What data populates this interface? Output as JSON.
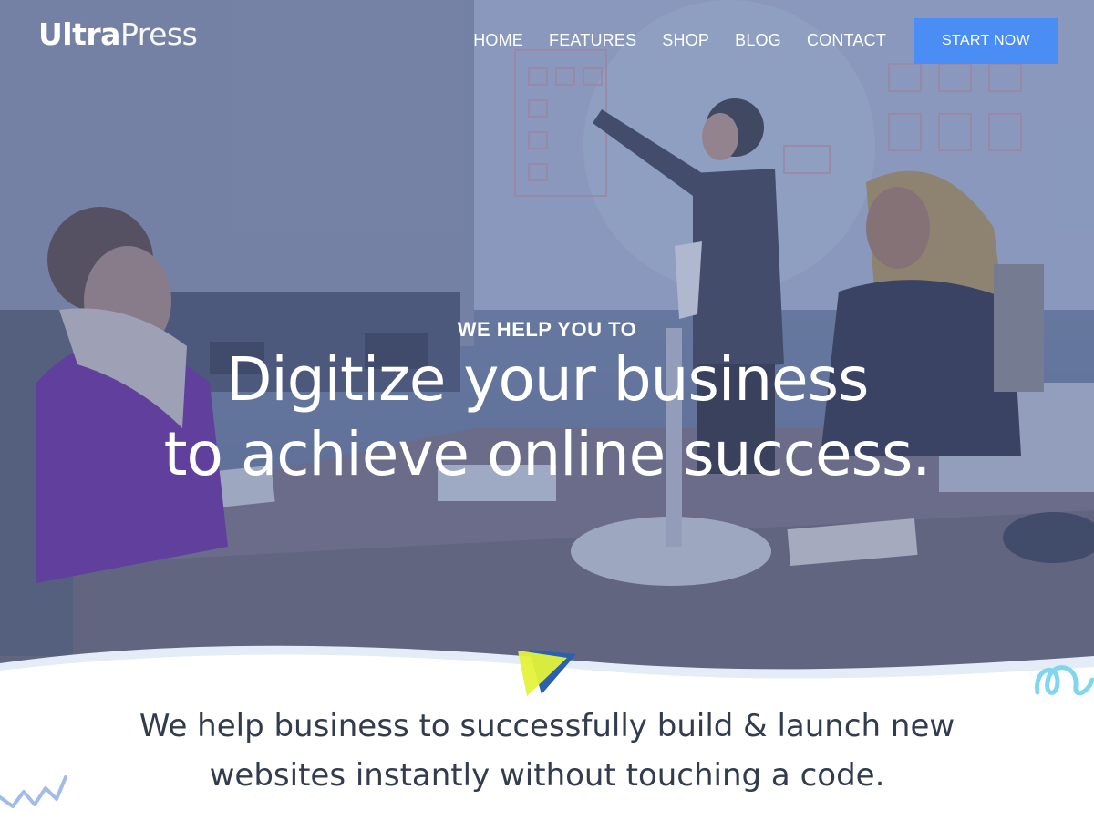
{
  "brand": {
    "name_bold": "Ultra",
    "name_light": "Press"
  },
  "nav": {
    "items": [
      "HOME",
      "FEATURES",
      "SHOP",
      "BLOG",
      "CONTACT"
    ],
    "cta_label": "START NOW"
  },
  "hero": {
    "eyebrow": "WE HELP YOU TO",
    "headline_line1": "Digitize your business",
    "headline_line2": "to achieve online success."
  },
  "intro": {
    "line1": "We help business to successfully build & launch new",
    "line2": "websites instantly without touching a code."
  },
  "colors": {
    "accent": "#4a8ef5",
    "hero_tint": "#4e6296",
    "tagline_text": "#333c4e",
    "deco_cyan": "#7fd6ee",
    "deco_yellow": "#e4f23a",
    "deco_blue": "#2b5fb0"
  },
  "icons": [
    "play-triangle-icon",
    "squiggle-decoration",
    "zigzag-decoration"
  ]
}
